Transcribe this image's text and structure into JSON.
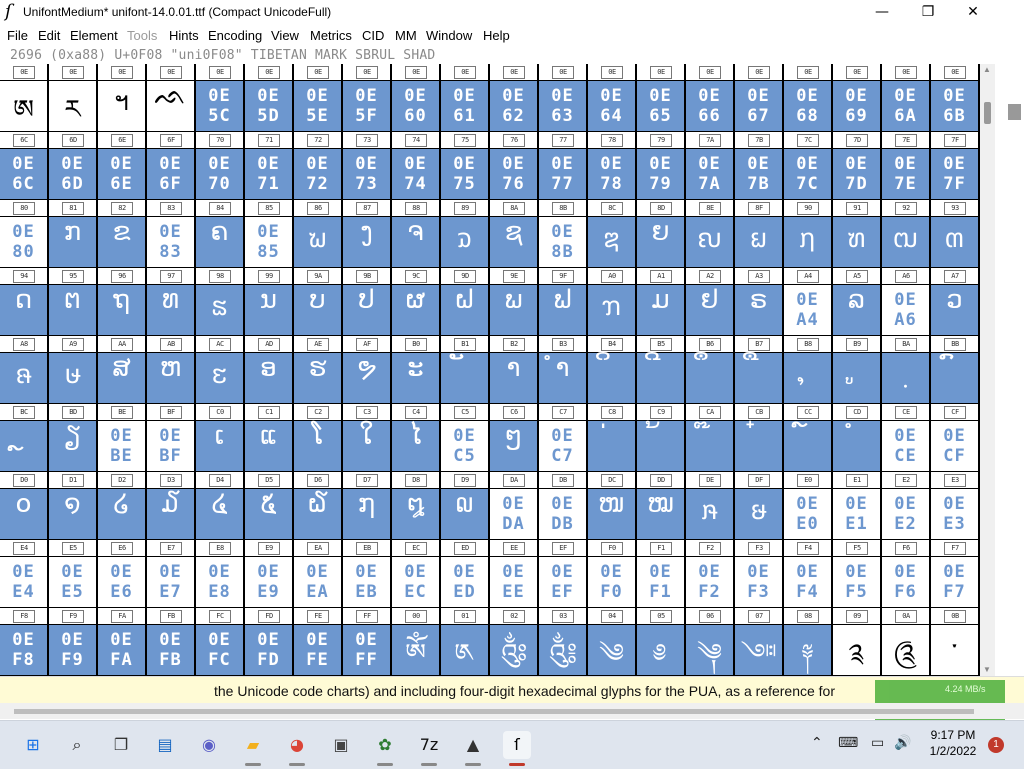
{
  "window": {
    "title": "UnifontMedium*  unifont-14.0.01.ttf (Compact UnicodeFull)",
    "app_icon": "fontforge-icon",
    "controls": {
      "minimize": "—",
      "maximize": "❐",
      "close": "✕"
    }
  },
  "menu": [
    {
      "label": "File",
      "enabled": true
    },
    {
      "label": "Edit",
      "enabled": true
    },
    {
      "label": "Element",
      "enabled": true
    },
    {
      "label": "Tools",
      "enabled": false
    },
    {
      "label": "Hints",
      "enabled": true
    },
    {
      "label": "Encoding",
      "enabled": true
    },
    {
      "label": "View",
      "enabled": true
    },
    {
      "label": "Metrics",
      "enabled": true
    },
    {
      "label": "CID",
      "enabled": true
    },
    {
      "label": "MM",
      "enabled": true
    },
    {
      "label": "Window",
      "enabled": true
    },
    {
      "label": "Help",
      "enabled": true
    }
  ],
  "info_line": "2696 (0xa88) U+0F08 \"uni0F08\" TIBETAN MARK SBRUL SHAD",
  "colors": {
    "selected": "#6d97cf",
    "unselected": "#ffffff",
    "status_bg": "#fffbd5"
  },
  "grid": {
    "rows": [
      {
        "labels": [
          "0E",
          "0E",
          "0E",
          "0E",
          "0E",
          "0E",
          "0E",
          "0E",
          "0E",
          "0E",
          "0E",
          "0E",
          "0E",
          "0E",
          "0E",
          "0E",
          "0E",
          "0E",
          "0E",
          "0E"
        ],
        "cells": [
          {
            "g": "ཨ",
            "s": 0
          },
          {
            "g": "ཪ",
            "s": 0
          },
          {
            "g": "ฯ",
            "s": 0
          },
          {
            "g": "ᨒ",
            "s": 0
          },
          {
            "h": "0E 5C",
            "s": 1
          },
          {
            "h": "0E 5D",
            "s": 1
          },
          {
            "h": "0E 5E",
            "s": 1
          },
          {
            "h": "0E 5F",
            "s": 1
          },
          {
            "h": "0E 60",
            "s": 1
          },
          {
            "h": "0E 61",
            "s": 1
          },
          {
            "h": "0E 62",
            "s": 1
          },
          {
            "h": "0E 63",
            "s": 1
          },
          {
            "h": "0E 64",
            "s": 1
          },
          {
            "h": "0E 65",
            "s": 1
          },
          {
            "h": "0E 66",
            "s": 1
          },
          {
            "h": "0E 67",
            "s": 1
          },
          {
            "h": "0E 68",
            "s": 1
          },
          {
            "h": "0E 69",
            "s": 1
          },
          {
            "h": "0E 6A",
            "s": 1
          },
          {
            "h": "0E 6B",
            "s": 1
          }
        ]
      },
      {
        "labels": [
          "6C",
          "6D",
          "6E",
          "6F",
          "70",
          "71",
          "72",
          "73",
          "74",
          "75",
          "76",
          "77",
          "78",
          "79",
          "7A",
          "7B",
          "7C",
          "7D",
          "7E",
          "7F"
        ],
        "cells": [
          {
            "h": "0E 6C",
            "s": 1
          },
          {
            "h": "0E 6D",
            "s": 1
          },
          {
            "h": "0E 6E",
            "s": 1
          },
          {
            "h": "0E 6F",
            "s": 1
          },
          {
            "h": "0E 70",
            "s": 1
          },
          {
            "h": "0E 71",
            "s": 1
          },
          {
            "h": "0E 72",
            "s": 1
          },
          {
            "h": "0E 73",
            "s": 1
          },
          {
            "h": "0E 74",
            "s": 1
          },
          {
            "h": "0E 75",
            "s": 1
          },
          {
            "h": "0E 76",
            "s": 1
          },
          {
            "h": "0E 77",
            "s": 1
          },
          {
            "h": "0E 78",
            "s": 1
          },
          {
            "h": "0E 79",
            "s": 1
          },
          {
            "h": "0E 7A",
            "s": 1
          },
          {
            "h": "0E 7B",
            "s": 1
          },
          {
            "h": "0E 7C",
            "s": 1
          },
          {
            "h": "0E 7D",
            "s": 1
          },
          {
            "h": "0E 7E",
            "s": 1
          },
          {
            "h": "0E 7F",
            "s": 1
          }
        ]
      },
      {
        "labels": [
          "80",
          "81",
          "82",
          "83",
          "84",
          "85",
          "86",
          "87",
          "88",
          "89",
          "8A",
          "8B",
          "8C",
          "8D",
          "8E",
          "8F",
          "90",
          "91",
          "92",
          "93"
        ],
        "cells": [
          {
            "h": "0E 80",
            "s": 0
          },
          {
            "g": "ກ",
            "s": 1
          },
          {
            "g": "ຂ",
            "s": 1
          },
          {
            "h": "0E 83",
            "s": 0
          },
          {
            "g": "ຄ",
            "s": 1
          },
          {
            "h": "0E 85",
            "s": 0
          },
          {
            "g": "ຆ",
            "s": 1
          },
          {
            "g": "ງ",
            "s": 1
          },
          {
            "g": "ຈ",
            "s": 1
          },
          {
            "g": "ຉ",
            "s": 1
          },
          {
            "g": "ຊ",
            "s": 1
          },
          {
            "h": "0E 8B",
            "s": 0
          },
          {
            "g": "ຌ",
            "s": 1
          },
          {
            "g": "ຍ",
            "s": 1
          },
          {
            "g": "ຎ",
            "s": 1
          },
          {
            "g": "ຏ",
            "s": 1
          },
          {
            "g": "ຐ",
            "s": 1
          },
          {
            "g": "ຑ",
            "s": 1
          },
          {
            "g": "ຒ",
            "s": 1
          },
          {
            "g": "ຓ",
            "s": 1
          }
        ]
      },
      {
        "labels": [
          "94",
          "95",
          "96",
          "97",
          "98",
          "99",
          "9A",
          "9B",
          "9C",
          "9D",
          "9E",
          "9F",
          "A0",
          "A1",
          "A2",
          "A3",
          "A4",
          "A5",
          "A6",
          "A7"
        ],
        "cells": [
          {
            "g": "ດ",
            "s": 1
          },
          {
            "g": "ຕ",
            "s": 1
          },
          {
            "g": "ຖ",
            "s": 1
          },
          {
            "g": "ທ",
            "s": 1
          },
          {
            "g": "ຘ",
            "s": 1
          },
          {
            "g": "ນ",
            "s": 1
          },
          {
            "g": "ບ",
            "s": 1
          },
          {
            "g": "ປ",
            "s": 1
          },
          {
            "g": "ຜ",
            "s": 1
          },
          {
            "g": "ຝ",
            "s": 1
          },
          {
            "g": "ພ",
            "s": 1
          },
          {
            "g": "ຟ",
            "s": 1
          },
          {
            "g": "ຠ",
            "s": 1
          },
          {
            "g": "ມ",
            "s": 1
          },
          {
            "g": "ຢ",
            "s": 1
          },
          {
            "g": "ຣ",
            "s": 1
          },
          {
            "h": "0E A4",
            "s": 0
          },
          {
            "g": "ລ",
            "s": 1
          },
          {
            "h": "0E A6",
            "s": 0
          },
          {
            "g": "ວ",
            "s": 1
          }
        ]
      },
      {
        "labels": [
          "A8",
          "A9",
          "AA",
          "AB",
          "AC",
          "AD",
          "AE",
          "AF",
          "B0",
          "B1",
          "B2",
          "B3",
          "B4",
          "B5",
          "B6",
          "B7",
          "B8",
          "B9",
          "BA",
          "BB"
        ],
        "cells": [
          {
            "g": "ຨ",
            "s": 1
          },
          {
            "g": "ຩ",
            "s": 1
          },
          {
            "g": "ສ",
            "s": 1
          },
          {
            "g": "ຫ",
            "s": 1
          },
          {
            "g": "ຬ",
            "s": 1
          },
          {
            "g": "ອ",
            "s": 1
          },
          {
            "g": "ຮ",
            "s": 1
          },
          {
            "g": "ຯ",
            "s": 1
          },
          {
            "g": "ະ",
            "s": 1
          },
          {
            "g": "ັ",
            "s": 1
          },
          {
            "g": "າ",
            "s": 1
          },
          {
            "g": "ຳ",
            "s": 1
          },
          {
            "g": "ິ",
            "s": 1
          },
          {
            "g": "ີ",
            "s": 1
          },
          {
            "g": "ຶ",
            "s": 1
          },
          {
            "g": "ື",
            "s": 1
          },
          {
            "g": "ຸ",
            "s": 1
          },
          {
            "g": "ູ",
            "s": 1
          },
          {
            "g": "຺",
            "s": 1
          },
          {
            "g": "ົ",
            "s": 1
          }
        ]
      },
      {
        "labels": [
          "BC",
          "BD",
          "BE",
          "BF",
          "C0",
          "C1",
          "C2",
          "C3",
          "C4",
          "C5",
          "C6",
          "C7",
          "C8",
          "C9",
          "CA",
          "CB",
          "CC",
          "CD",
          "CE",
          "CF"
        ],
        "cells": [
          {
            "g": "ຼ",
            "s": 1
          },
          {
            "g": "ຽ",
            "s": 1
          },
          {
            "h": "0E BE",
            "s": 0
          },
          {
            "h": "0E BF",
            "s": 0
          },
          {
            "g": "ເ",
            "s": 1
          },
          {
            "g": "ແ",
            "s": 1
          },
          {
            "g": "ໂ",
            "s": 1
          },
          {
            "g": "ໃ",
            "s": 1
          },
          {
            "g": "ໄ",
            "s": 1
          },
          {
            "h": "0E C5",
            "s": 0
          },
          {
            "g": "ໆ",
            "s": 1
          },
          {
            "h": "0E C7",
            "s": 0
          },
          {
            "g": "່",
            "s": 1
          },
          {
            "g": "້",
            "s": 1
          },
          {
            "g": "໊",
            "s": 1
          },
          {
            "g": "໋",
            "s": 1
          },
          {
            "g": "໌",
            "s": 1
          },
          {
            "g": "ໍ",
            "s": 1
          },
          {
            "h": "0E CE",
            "s": 0
          },
          {
            "h": "0E CF",
            "s": 0
          }
        ]
      },
      {
        "labels": [
          "D0",
          "D1",
          "D2",
          "D3",
          "D4",
          "D5",
          "D6",
          "D7",
          "D8",
          "D9",
          "DA",
          "DB",
          "DC",
          "DD",
          "DE",
          "DF",
          "E0",
          "E1",
          "E2",
          "E3"
        ],
        "cells": [
          {
            "g": "໐",
            "s": 1
          },
          {
            "g": "໑",
            "s": 1
          },
          {
            "g": "໒",
            "s": 1
          },
          {
            "g": "໓",
            "s": 1
          },
          {
            "g": "໔",
            "s": 1
          },
          {
            "g": "໕",
            "s": 1
          },
          {
            "g": "໖",
            "s": 1
          },
          {
            "g": "໗",
            "s": 1
          },
          {
            "g": "໘",
            "s": 1
          },
          {
            "g": "໙",
            "s": 1
          },
          {
            "h": "0E DA",
            "s": 0
          },
          {
            "h": "0E DB",
            "s": 0
          },
          {
            "g": "ໜ",
            "s": 1
          },
          {
            "g": "ໝ",
            "s": 1
          },
          {
            "g": "ໞ",
            "s": 1
          },
          {
            "g": "ໟ",
            "s": 1
          },
          {
            "h": "0E E0",
            "s": 0
          },
          {
            "h": "0E E1",
            "s": 0
          },
          {
            "h": "0E E2",
            "s": 0
          },
          {
            "h": "0E E3",
            "s": 0
          }
        ]
      },
      {
        "labels": [
          "E4",
          "E5",
          "E6",
          "E7",
          "E8",
          "E9",
          "EA",
          "EB",
          "EC",
          "ED",
          "EE",
          "EF",
          "F0",
          "F1",
          "F2",
          "F3",
          "F4",
          "F5",
          "F6",
          "F7"
        ],
        "cells": [
          {
            "h": "0E E4",
            "s": 0
          },
          {
            "h": "0E E5",
            "s": 0
          },
          {
            "h": "0E E6",
            "s": 0
          },
          {
            "h": "0E E7",
            "s": 0
          },
          {
            "h": "0E E8",
            "s": 0
          },
          {
            "h": "0E E9",
            "s": 0
          },
          {
            "h": "0E EA",
            "s": 0
          },
          {
            "h": "0E EB",
            "s": 0
          },
          {
            "h": "0E EC",
            "s": 0
          },
          {
            "h": "0E ED",
            "s": 0
          },
          {
            "h": "0E EE",
            "s": 0
          },
          {
            "h": "0E EF",
            "s": 0
          },
          {
            "h": "0E F0",
            "s": 0
          },
          {
            "h": "0E F1",
            "s": 0
          },
          {
            "h": "0E F2",
            "s": 0
          },
          {
            "h": "0E F3",
            "s": 0
          },
          {
            "h": "0E F4",
            "s": 0
          },
          {
            "h": "0E F5",
            "s": 0
          },
          {
            "h": "0E F6",
            "s": 0
          },
          {
            "h": "0E F7",
            "s": 0
          }
        ]
      },
      {
        "labels": [
          "F8",
          "F9",
          "FA",
          "FB",
          "FC",
          "FD",
          "FE",
          "FF",
          "00",
          "01",
          "02",
          "03",
          "04",
          "05",
          "06",
          "07",
          "08",
          "09",
          "0A",
          "0B"
        ],
        "cells": [
          {
            "h": "0E F8",
            "s": 1
          },
          {
            "h": "0E F9",
            "s": 1
          },
          {
            "h": "0E FA",
            "s": 1
          },
          {
            "h": "0E FB",
            "s": 1
          },
          {
            "h": "0E FC",
            "s": 1
          },
          {
            "h": "0E FD",
            "s": 1
          },
          {
            "h": "0E FE",
            "s": 1
          },
          {
            "h": "0E FF",
            "s": 1
          },
          {
            "g": "ༀ",
            "s": 1
          },
          {
            "g": "༁",
            "s": 1
          },
          {
            "g": "༂",
            "s": 1
          },
          {
            "g": "༃",
            "s": 1
          },
          {
            "g": "༄",
            "s": 1
          },
          {
            "g": "༅",
            "s": 1
          },
          {
            "g": "༆",
            "s": 1
          },
          {
            "g": "༇",
            "s": 1
          },
          {
            "g": "༈",
            "s": 1
          },
          {
            "g": "༉",
            "s": 0
          },
          {
            "g": "༊",
            "s": 0
          },
          {
            "g": "་",
            "s": 0
          }
        ]
      }
    ]
  },
  "status_text": "the Unicode code charts) and including four-digit hexadecimal glyphs for the PUA, as a reference for",
  "net_widget": "4.24 MB/s",
  "taskbar": {
    "apps": [
      {
        "name": "start-icon",
        "glyph": "⊞",
        "color": "#1a73e8"
      },
      {
        "name": "search-icon",
        "glyph": "⌕",
        "color": "#222"
      },
      {
        "name": "task-view-icon",
        "glyph": "❐",
        "color": "#333"
      },
      {
        "name": "widgets-icon",
        "glyph": "▤",
        "color": "#1565c0"
      },
      {
        "name": "teams-chat-icon",
        "glyph": "◉",
        "color": "#5b5fc7"
      },
      {
        "name": "file-explorer-icon",
        "glyph": "▰",
        "color": "#f2b01e"
      },
      {
        "name": "chrome-icon",
        "glyph": "◕",
        "color": "#db4437"
      },
      {
        "name": "store-icon",
        "glyph": "▣",
        "color": "#444"
      },
      {
        "name": "image-viewer-icon",
        "glyph": "✿",
        "color": "#2e7d32"
      },
      {
        "name": "7zip-icon",
        "glyph": "7z",
        "color": "#111"
      },
      {
        "name": "inkscape-icon",
        "glyph": "▲",
        "color": "#333"
      },
      {
        "name": "fontforge-icon",
        "glyph": "ſ",
        "color": "#000"
      }
    ],
    "tray": {
      "chevron": "⌃",
      "keyboard": "⌨",
      "monitor": "▭",
      "volume": "🔊"
    },
    "time": "9:17 PM",
    "date": "1/2/2022",
    "notifications": "1"
  }
}
